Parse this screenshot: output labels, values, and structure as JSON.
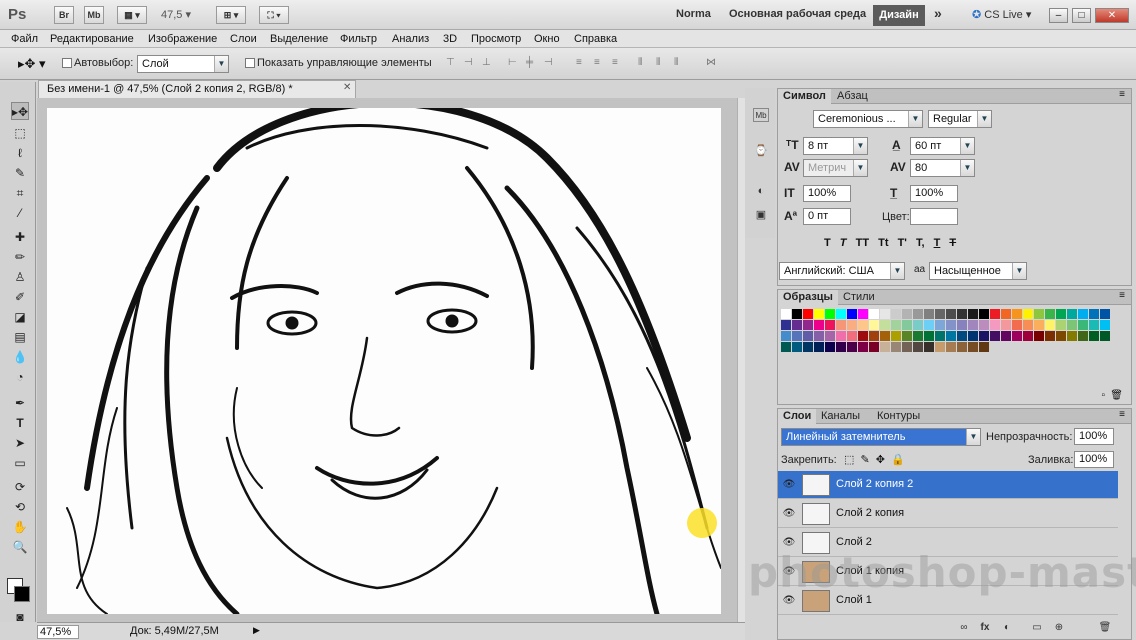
{
  "app": {
    "logo": "Ps",
    "launch_buttons": [
      "Br",
      "Mb"
    ],
    "zoom": "47,5",
    "workspaces": [
      "Norma",
      "Основная рабочая среда"
    ],
    "active_workspace": "Дизайн",
    "more": "»",
    "cslive": "CS Live",
    "window_controls": [
      "–",
      "□",
      "✕"
    ]
  },
  "menu": [
    "Файл",
    "Редактирование",
    "Изображение",
    "Слои",
    "Выделение",
    "Фильтр",
    "Анализ",
    "3D",
    "Просмотр",
    "Окно",
    "Справка"
  ],
  "options": {
    "autoselect_label": "Автовыбор:",
    "autoselect_value": "Слой",
    "show_controls_label": "Показать управляющие элементы"
  },
  "document": {
    "tab_title": "Без имени-1 @ 47,5% (Слой 2 копия 2, RGB/8) *",
    "close": "✕",
    "status_zoom": "47,5%",
    "status_doc": "Док: 5,49M/27,5M"
  },
  "character": {
    "tabs": [
      "Символ",
      "Абзац"
    ],
    "font_family": "Ceremonious ...",
    "font_style": "Regular",
    "size": "8 пт",
    "leading": "60 пт",
    "kerning": "Метрич",
    "tracking": "80",
    "vscale": "100%",
    "hscale": "100%",
    "baseline": "0 пт",
    "color_label": "Цвет:",
    "style_buttons": [
      "T",
      "T",
      "TT",
      "Tt",
      "T'",
      "T,",
      "T",
      "T"
    ],
    "language": "Английский: США",
    "aa_label": "aa",
    "antialias": "Насыщенное"
  },
  "swatches": {
    "tabs": [
      "Образцы",
      "Стили"
    ],
    "colors": [
      "#ffffff",
      "#000000",
      "#ff0000",
      "#ffff00",
      "#00ff00",
      "#00ffff",
      "#0000ff",
      "#ff00ff",
      "#ffffff",
      "#e6e6e6",
      "#cccccc",
      "#b3b3b3",
      "#999999",
      "#808080",
      "#666666",
      "#4d4d4d",
      "#333333",
      "#1a1a1a",
      "#000000",
      "#ed1c24",
      "#f26522",
      "#f7941d",
      "#fff200",
      "#8dc63f",
      "#39b54a",
      "#00a651",
      "#00a99d",
      "#00aeef",
      "#0072bc",
      "#0054a6",
      "#2e3192",
      "#662d91",
      "#92278f",
      "#ec008c",
      "#ed145b",
      "#f69679",
      "#f9ad81",
      "#fdc68a",
      "#fff799",
      "#c4df9b",
      "#a3d39c",
      "#82ca9c",
      "#7accc8",
      "#6dcff6",
      "#7da7d9",
      "#8393ca",
      "#8781bd",
      "#a186be",
      "#bd8cbf",
      "#f49ac1",
      "#f5989d",
      "#f26c4f",
      "#f68e55",
      "#fbaf5d",
      "#fff467",
      "#acd373",
      "#7cc576",
      "#3bb878",
      "#1abbb4",
      "#00bff3",
      "#448ccb",
      "#5574b9",
      "#605ca8",
      "#8560a8",
      "#a864a8",
      "#f06eaa",
      "#f26d7d",
      "#9e0b0f",
      "#a0410d",
      "#a3620a",
      "#aba000",
      "#598527",
      "#1a7b30",
      "#007236",
      "#00746b",
      "#0076a3",
      "#004a80",
      "#003471",
      "#1b1464",
      "#440e62",
      "#630460",
      "#9e005d",
      "#9e0039",
      "#790000",
      "#7b2e00",
      "#7d4900",
      "#827b00",
      "#406618",
      "#005e20",
      "#005826",
      "#005952",
      "#005b7f",
      "#003663",
      "#002157",
      "#0d004c",
      "#32004b",
      "#4b0049",
      "#7b0046",
      "#7a0026",
      "#c7b299",
      "#998675",
      "#736357",
      "#534741",
      "#37302a",
      "#c69c6d",
      "#a67c52",
      "#8c6239",
      "#754c24",
      "#603913"
    ]
  },
  "layers": {
    "tabs": [
      "Слои",
      "Каналы",
      "Контуры"
    ],
    "blend_mode": "Линейный затемнитель",
    "opacity_label": "Непрозрачность:",
    "opacity": "100%",
    "lock_label": "Закрепить:",
    "fill_label": "Заливка:",
    "fill": "100%",
    "items": [
      {
        "name": "Слой 2 копия 2"
      },
      {
        "name": "Слой 2 копия"
      },
      {
        "name": "Слой 2"
      },
      {
        "name": "Слой 1 копия"
      },
      {
        "name": "Слой 1"
      }
    ],
    "footer_buttons": [
      "∞",
      "fx",
      "◐",
      "▭",
      "⊕",
      "🗑"
    ]
  },
  "watermark": "photoshop-master.ru"
}
